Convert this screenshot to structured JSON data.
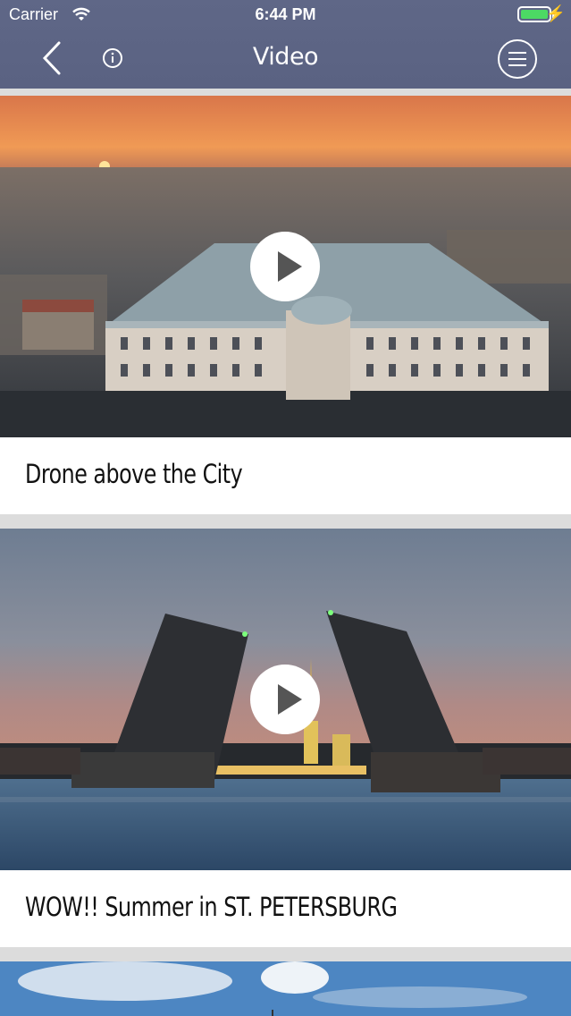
{
  "status": {
    "carrier": "Carrier",
    "time": "6:44 PM"
  },
  "nav": {
    "title": "Video"
  },
  "videos": [
    {
      "title": "Drone above the City"
    },
    {
      "title": "WOW!! Summer in ST. PETERSBURG"
    },
    {
      "title": ""
    }
  ],
  "colors": {
    "navbar": "#5f6787",
    "battery": "#4cd964",
    "background": "#dcdcdc"
  },
  "icons": {
    "back": "chevron-left-icon",
    "info": "info-icon",
    "menu": "hamburger-icon",
    "play": "play-icon"
  }
}
